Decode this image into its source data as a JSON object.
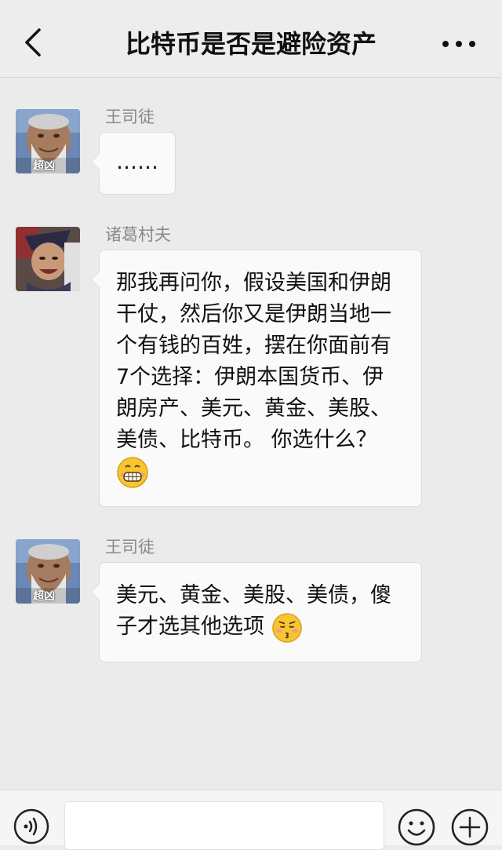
{
  "header": {
    "title": "比特币是否是避险资产",
    "back_icon": "chevron-left-icon",
    "more_icon": "more-dots-icon"
  },
  "messages": [
    {
      "sender": "王司徒",
      "avatar_caption": "超凶",
      "text": "……"
    },
    {
      "sender": "诸葛村夫",
      "lines": [
        "那我再问你，假设美国和伊朗",
        "干仗，然后你又是伊朗当地一",
        "个有钱的百姓，摆在你面前有",
        "7个选择：伊朗本国货币、伊",
        "朗房产、美元、黄金、美股、",
        "美债、比特币。 你选什么？"
      ],
      "emoji": "grinning-face-emoji"
    },
    {
      "sender": "王司徒",
      "avatar_caption": "超凶",
      "lines": [
        "美元、黄金、美股、美债，傻",
        "子才选其他选项"
      ],
      "emoji": "smirking-kissing-face-emoji"
    }
  ],
  "input_bar": {
    "voice_icon": "voice-icon",
    "emoji_icon": "emoji-face-icon",
    "plus_icon": "plus-circle-icon",
    "input_value": ""
  },
  "colors": {
    "background": "#ebebeb",
    "bubble": "#fafafa",
    "sender_name": "#8a8a8a"
  }
}
